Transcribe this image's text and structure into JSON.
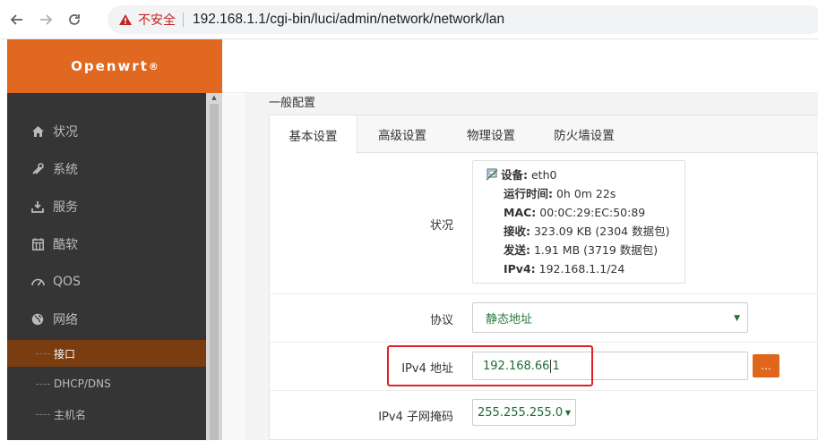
{
  "browser": {
    "insecure_label": "不安全",
    "url": "192.168.1.1/cgi-bin/luci/admin/network/network/lan"
  },
  "brand": {
    "name": "Openwrt",
    "mark": "®"
  },
  "sidebar": {
    "items": [
      {
        "label": "状况",
        "icon": "home-icon"
      },
      {
        "label": "系统",
        "icon": "tools-icon"
      },
      {
        "label": "服务",
        "icon": "download-icon"
      },
      {
        "label": "酷软",
        "icon": "calendar-icon"
      },
      {
        "label": "QOS",
        "icon": "gauge-icon"
      },
      {
        "label": "网络",
        "icon": "globe-icon"
      }
    ],
    "subitems": [
      {
        "label": "接口",
        "active": true
      },
      {
        "label": "DHCP/DNS",
        "active": false
      },
      {
        "label": "主机名",
        "active": false
      }
    ]
  },
  "main": {
    "section_title": "一般配置",
    "tabs": [
      "基本设置",
      "高级设置",
      "物理设置",
      "防火墙设置"
    ],
    "status": {
      "label": "状况",
      "device_key": "设备:",
      "device_val": " eth0",
      "uptime_key": "运行时间:",
      "uptime_val": " 0h 0m 22s",
      "mac_key": "MAC:",
      "mac_val": " 00:0C:29:EC:50:89",
      "rx_key": "接收:",
      "rx_val": " 323.09 KB (2304 数据包)",
      "tx_key": "发送:",
      "tx_val": " 1.91 MB (3719 数据包)",
      "ipv4_key": "IPv4:",
      "ipv4_val": " 192.168.1.1/24"
    },
    "protocol": {
      "label": "协议",
      "value": "静态地址"
    },
    "ipv4_address": {
      "label": "IPv4 地址",
      "value_before_cursor": "192.168.66",
      "value_after_cursor": "1",
      "button": "..."
    },
    "ipv4_netmask": {
      "label": "IPv4 子网掩码",
      "value": "255.255.255.0"
    }
  },
  "colors": {
    "accent": "#e06820",
    "sidebar_bg": "#353535",
    "active_sub": "#7a3d10",
    "value_green": "#1d6e33",
    "highlight": "#e0202a"
  }
}
